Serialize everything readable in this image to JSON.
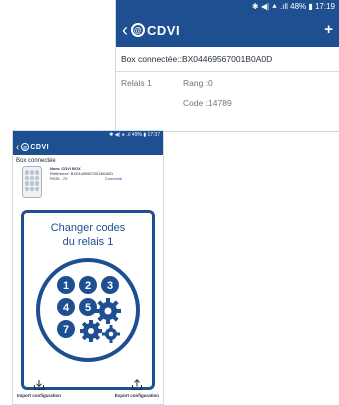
{
  "screen_top": {
    "status": "✱ ◀| ⯅ .ıll 48% ▮ 17:19",
    "logo_text": "CDVI",
    "logo_mark": "@",
    "back_icon": "chevron-left-icon",
    "add_icon": "plus-icon",
    "box_label": "Box connectée::BX04469567001B0A0D",
    "relay_label": "Relais 1",
    "rank_label": "Rang :0",
    "code_label": "Code :14789"
  },
  "screen_bottom": {
    "status": "✱ ◀| ⯅ .ıl 49% ▮ 17:37",
    "logo_text": "CDVI",
    "logo_mark": "@",
    "section_title": "Box connectée",
    "box_name": "Nom: CDVI BOX",
    "box_reference": "Référence: BX04469567001B0A0D",
    "box_rssi": "RSSI: -70",
    "box_status": "Connecté",
    "card_heading_line1": "Changer codes",
    "card_heading_line2": "du relais 1",
    "keypad_digits": [
      "1",
      "2",
      "3",
      "4",
      "5",
      "7"
    ],
    "import_label": "Import configuration",
    "export_label": "Export configuration"
  },
  "colors": {
    "brand_blue": "#1d4f91",
    "text_dark": "#1f2d3d",
    "text_muted": "#6b7580"
  }
}
